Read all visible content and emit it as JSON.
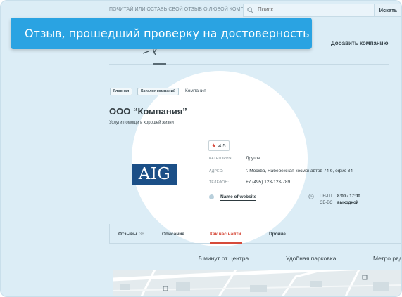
{
  "header": {
    "tagline": "ПОЧИТАЙ ИЛИ ОСТАВЬ СВОЙ ОТЗЫВ О ЛЮБОЙ КОМПАНИИ",
    "search_placeholder": "Поиск",
    "search_button": "Искать"
  },
  "banner": {
    "text": "Отзыв, прошедший проверку на достоверность"
  },
  "nav": {
    "add_company": "Добавить компанию"
  },
  "breadcrumbs": [
    "Главная",
    "Каталог компаний",
    "Компания"
  ],
  "company": {
    "name": "ООО “Компания”",
    "slogan": "Услуги помощи в хорошей жизни",
    "logo_text": "AIG",
    "logo_color": "#1b4f87",
    "rating": "4,5",
    "details": [
      {
        "label": "КАТЕГОРИЯ:",
        "value": "Другое"
      },
      {
        "label": "АДРЕС:",
        "value": "г. Москва, Набережная космонавтов 74 б, офис 34"
      },
      {
        "label": "ТЕЛЕФОН:",
        "value": "+7 (495) 123-123-789"
      }
    ],
    "website": "Name of website",
    "hours": [
      {
        "days": "ПН-ПТ",
        "time": "8:00 - 17:00"
      },
      {
        "days": "СБ-ВС",
        "time": "выходной"
      }
    ]
  },
  "tabs": [
    {
      "label": "Отзывы",
      "count": "38"
    },
    {
      "label": "Описание"
    },
    {
      "label": "Как нас найти"
    },
    {
      "label": "Прочие"
    }
  ],
  "features": [
    "5 минут от центра",
    "Удобная парковка",
    "Метро ряд"
  ],
  "colors": {
    "banner": "#2aa3e2",
    "accent": "#d64a3a",
    "background": "#dcedf6"
  }
}
